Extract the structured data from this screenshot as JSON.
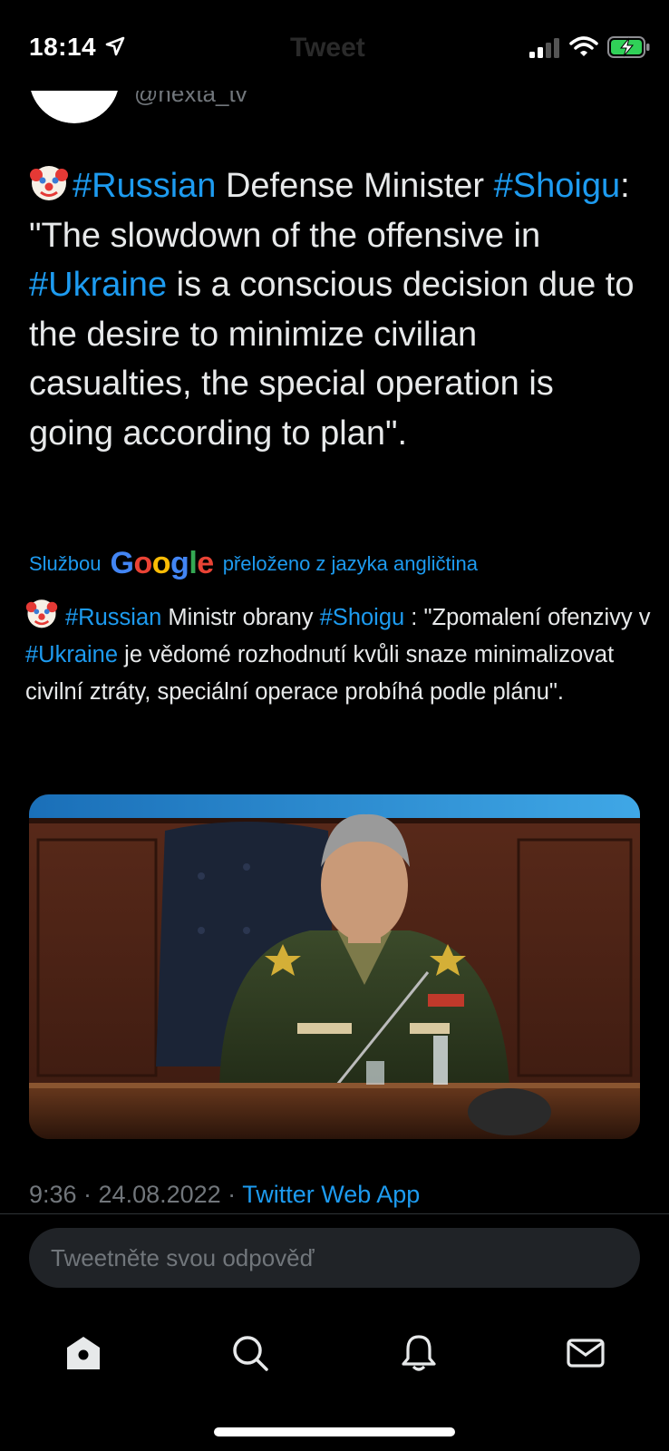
{
  "status_bar": {
    "time": "18:14",
    "header_title": "Tweet"
  },
  "author": {
    "handle": "@nexta_tv"
  },
  "tweet": {
    "emoji": "clown-face",
    "seg1": "#Russian",
    "seg2": " Defense Minister ",
    "seg3": "#Shoigu",
    "seg4": ": \"The slowdown of the offensive in ",
    "seg5": "#Ukraine",
    "seg6": " is a conscious decision due to the desire to minimize civilian casualties, the special operation is going according to plan\"."
  },
  "translation": {
    "prefix": "Službou",
    "google": "Google",
    "suffix": "přeloženo z jazyka angličtina",
    "seg1": "#Russian",
    "seg2": " Ministr obrany ",
    "seg3": "#Shoigu",
    "seg4": " : \"Zpomalení ofenzivy v ",
    "seg5": "#Ukraine",
    "seg6": " je vědomé rozhodnutí kvůli snaze minimalizovat civilní ztráty, speciální operace probíhá podle plánu\"."
  },
  "meta": {
    "time_date": "9:36 · 24.08.2022 · ",
    "source": "Twitter Web App"
  },
  "reply": {
    "placeholder": "Tweetněte svou odpověď"
  },
  "nav": [
    "home-icon",
    "search-icon",
    "notifications-icon",
    "messages-icon"
  ],
  "colors": {
    "accent": "#1d9bf0",
    "background": "#000000",
    "text": "#e7e9ea",
    "muted": "#71767b"
  }
}
